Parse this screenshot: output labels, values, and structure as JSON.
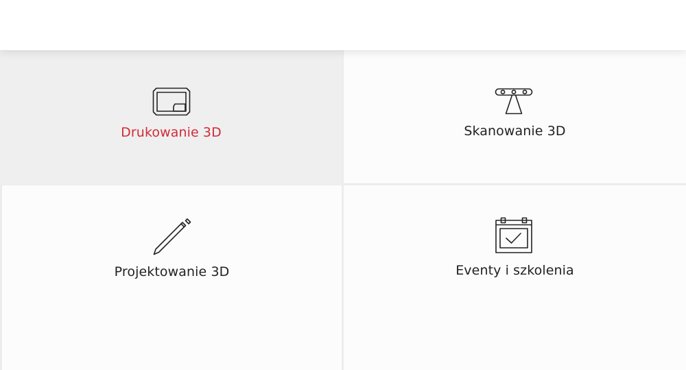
{
  "services": [
    {
      "label": "Drukowanie 3D",
      "icon": "3d-printer-icon",
      "active": true
    },
    {
      "label": "Skanowanie 3D",
      "icon": "3d-scanner-icon",
      "active": false
    },
    {
      "label": "Projektowanie 3D",
      "icon": "pencil-icon",
      "active": false
    },
    {
      "label": "Eventy i szkolenia",
      "icon": "calendar-check-icon",
      "active": false
    }
  ],
  "colors": {
    "accent": "#d02b37",
    "text": "#222222",
    "tile": "#fcfcfc",
    "tile_active": "#efefef",
    "divider": "#ececec"
  }
}
